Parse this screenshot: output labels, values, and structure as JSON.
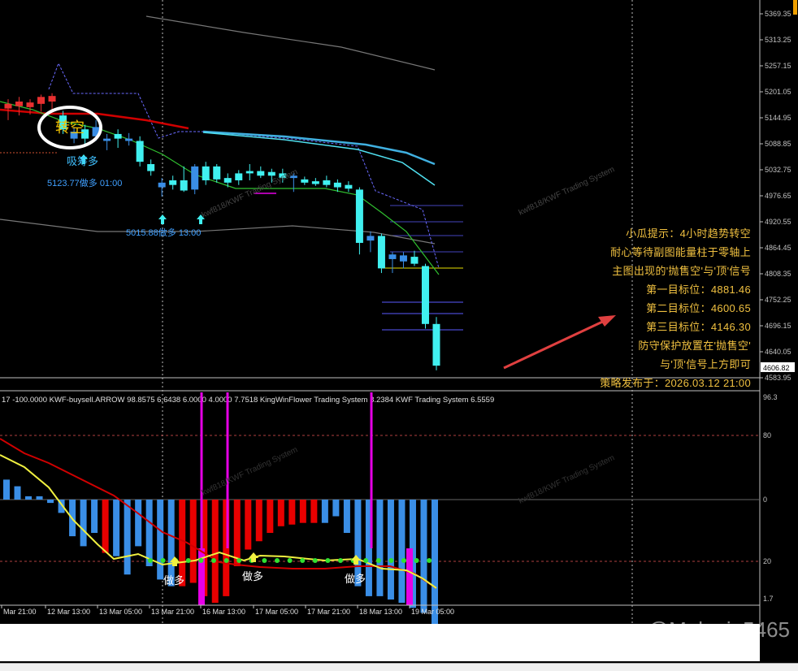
{
  "watermark": "@Melanie5465",
  "annotations": {
    "lines": [
      "小瓜提示：4小时趋势转空",
      "耐心等待副图能量柱于零轴上",
      "主图出现的'抛售空'与'顶'信号",
      "第一目标位：4881.46",
      "第二目标位：4600.65",
      "第三目标位：4146.30",
      "防守保护放置在'抛售空'",
      "与'顶'信号上方即可",
      "策略发布于：2026.03.12 21:00"
    ]
  },
  "chart_data": [
    {
      "type": "candlestick",
      "price_ticks": [
        "5369.35",
        "5313.25",
        "5257.15",
        "5201.05",
        "5144.95",
        "5088.85",
        "5032.75",
        "4976.65",
        "4920.55",
        "4864.45",
        "4808.35",
        "4752.25",
        "4696.15",
        "4640.05",
        "4583.95"
      ],
      "current_price": "4606.82",
      "ylim": [
        4583.95,
        5369.35
      ],
      "labels": {
        "turn_short": "转空",
        "buy1": "吸筹多",
        "price1": "5123.77做多 01:00",
        "price2": "5015.88做多 13:00",
        "watermark": "kwf818/KWF Trading System"
      },
      "candles": [
        {
          "o": 5165,
          "h": 5185,
          "l": 5140,
          "c": 5175,
          "col": "red"
        },
        {
          "o": 5170,
          "h": 5190,
          "l": 5150,
          "c": 5180,
          "col": "red"
        },
        {
          "o": 5168,
          "h": 5185,
          "l": 5152,
          "c": 5178,
          "col": "red"
        },
        {
          "o": 5175,
          "h": 5195,
          "l": 5158,
          "c": 5190,
          "col": "red"
        },
        {
          "o": 5180,
          "h": 5198,
          "l": 5160,
          "c": 5192,
          "col": "red"
        },
        {
          "o": 5150,
          "h": 5160,
          "l": 5110,
          "c": 5120,
          "col": "cyan"
        },
        {
          "o": 5115,
          "h": 5125,
          "l": 5090,
          "c": 5100,
          "col": "blue"
        },
        {
          "o": 5100,
          "h": 5130,
          "l": 5085,
          "c": 5120,
          "col": "cyan"
        },
        {
          "o": 5125,
          "h": 5140,
          "l": 5095,
          "c": 5105,
          "col": "blue"
        },
        {
          "o": 5095,
          "h": 5110,
          "l": 5075,
          "c": 5100,
          "col": "blue"
        },
        {
          "o": 5100,
          "h": 5120,
          "l": 5080,
          "c": 5110,
          "col": "cyan"
        },
        {
          "o": 5100,
          "h": 5112,
          "l": 5085,
          "c": 5095,
          "col": "blue"
        },
        {
          "o": 5095,
          "h": 5105,
          "l": 5040,
          "c": 5050,
          "col": "cyan"
        },
        {
          "o": 5045,
          "h": 5055,
          "l": 5020,
          "c": 5030,
          "col": "cyan"
        },
        {
          "o": 5005,
          "h": 5015,
          "l": 4975,
          "c": 4995,
          "col": "blue"
        },
        {
          "o": 5000,
          "h": 5020,
          "l": 4990,
          "c": 5010,
          "col": "cyan"
        },
        {
          "o": 5010,
          "h": 5040,
          "l": 4985,
          "c": 4988,
          "col": "cyan"
        },
        {
          "o": 4990,
          "h": 5045,
          "l": 4980,
          "c": 5040,
          "col": "blue"
        },
        {
          "o": 5040,
          "h": 5050,
          "l": 5000,
          "c": 5010,
          "col": "cyan"
        },
        {
          "o": 5012,
          "h": 5045,
          "l": 5005,
          "c": 5040,
          "col": "cyan"
        },
        {
          "o": 5015,
          "h": 5025,
          "l": 4995,
          "c": 5005,
          "col": "cyan"
        },
        {
          "o": 5010,
          "h": 5032,
          "l": 5000,
          "c": 5025,
          "col": "cyan"
        },
        {
          "o": 5025,
          "h": 5045,
          "l": 5010,
          "c": 5030,
          "col": "cyan"
        },
        {
          "o": 5030,
          "h": 5040,
          "l": 5015,
          "c": 5020,
          "col": "cyan"
        },
        {
          "o": 5020,
          "h": 5035,
          "l": 5005,
          "c": 5028,
          "col": "cyan"
        },
        {
          "o": 5025,
          "h": 5035,
          "l": 5005,
          "c": 5015,
          "col": "cyan"
        },
        {
          "o": 5015,
          "h": 5025,
          "l": 4985,
          "c": 5020,
          "col": "blue"
        },
        {
          "o": 5012,
          "h": 5018,
          "l": 5000,
          "c": 5005,
          "col": "cyan"
        },
        {
          "o": 5008,
          "h": 5015,
          "l": 4998,
          "c": 5002,
          "col": "cyan"
        },
        {
          "o": 5010,
          "h": 5020,
          "l": 4995,
          "c": 5000,
          "col": "cyan"
        },
        {
          "o": 5005,
          "h": 5012,
          "l": 4985,
          "c": 4995,
          "col": "cyan"
        },
        {
          "o": 5000,
          "h": 5008,
          "l": 4985,
          "c": 4992,
          "col": "cyan"
        },
        {
          "o": 4990,
          "h": 4995,
          "l": 4850,
          "c": 4875,
          "col": "cyan"
        },
        {
          "o": 4880,
          "h": 4900,
          "l": 4855,
          "c": 4890,
          "col": "blue"
        },
        {
          "o": 4890,
          "h": 4895,
          "l": 4810,
          "c": 4820,
          "col": "cyan"
        },
        {
          "o": 4840,
          "h": 4855,
          "l": 4810,
          "c": 4850,
          "col": "blue"
        },
        {
          "o": 4835,
          "h": 4855,
          "l": 4820,
          "c": 4848,
          "col": "blue"
        },
        {
          "o": 4845,
          "h": 4858,
          "l": 4825,
          "c": 4830,
          "col": "cyan"
        },
        {
          "o": 4825,
          "h": 4830,
          "l": 4690,
          "c": 4700,
          "col": "cyan"
        },
        {
          "o": 4700,
          "h": 4715,
          "l": 4600,
          "c": 4610,
          "col": "cyan"
        }
      ]
    },
    {
      "type": "bar",
      "title": "KWF-buysell.ARROW 98.8575 6.6438 6.0000 4.0000 7.7518  KingWinFlower Trading System 8.2384  KWF Trading System 6.5559",
      "left_label": "17 -100.0000",
      "y_ticks": [
        "96.3",
        "80",
        "0",
        "20",
        "1.7"
      ],
      "buy_labels": [
        "做多",
        "做多",
        "做多"
      ],
      "x_ticks": [
        "Mar 21:00",
        "12 Mar 13:00",
        "13 Mar 05:00",
        "13 Mar 21:00",
        "16 Mar 13:00",
        "17 Mar 05:00",
        "17 Mar 21:00",
        "18 Mar 13:00",
        "19 Mar 05:00"
      ],
      "values": [
        12,
        8,
        2,
        2,
        -2,
        -8,
        -22,
        -28,
        -20,
        -32,
        -34,
        -45,
        -28,
        -40,
        -48,
        -52,
        -52,
        -50,
        -58,
        -62,
        -58,
        -40,
        -30,
        -25,
        -20,
        -16,
        -15,
        -14,
        -14,
        -14,
        -10,
        -20,
        -52,
        -58,
        -58,
        -60,
        -62,
        -65,
        -68,
        -75
      ],
      "colors": [
        "#3a8ee6",
        "#3a8ee6",
        "#3a8ee6",
        "#3a8ee6",
        "#3a8ee6",
        "#3a8ee6",
        "#3a8ee6",
        "#3a8ee6",
        "#3a8ee6",
        "#e80000",
        "#3a8ee6",
        "#3a8ee6",
        "#3a8ee6",
        "#3a8ee6",
        "#3a8ee6",
        "#3a8ee6",
        "#e80000",
        "#e80000",
        "#e80000",
        "#e80000",
        "#e80000",
        "#e80000",
        "#e80000",
        "#e80000",
        "#e80000",
        "#e80000",
        "#e80000",
        "#e80000",
        "#e80000",
        "#3a8ee6",
        "#3a8ee6",
        "#3a8ee6",
        "#3a8ee6",
        "#3a8ee6",
        "#3a8ee6",
        "#3a8ee6",
        "#3a8ee6",
        "#3a8ee6",
        "#3a8ee6",
        "#3a8ee6"
      ],
      "accent": "#e600e6"
    }
  ]
}
